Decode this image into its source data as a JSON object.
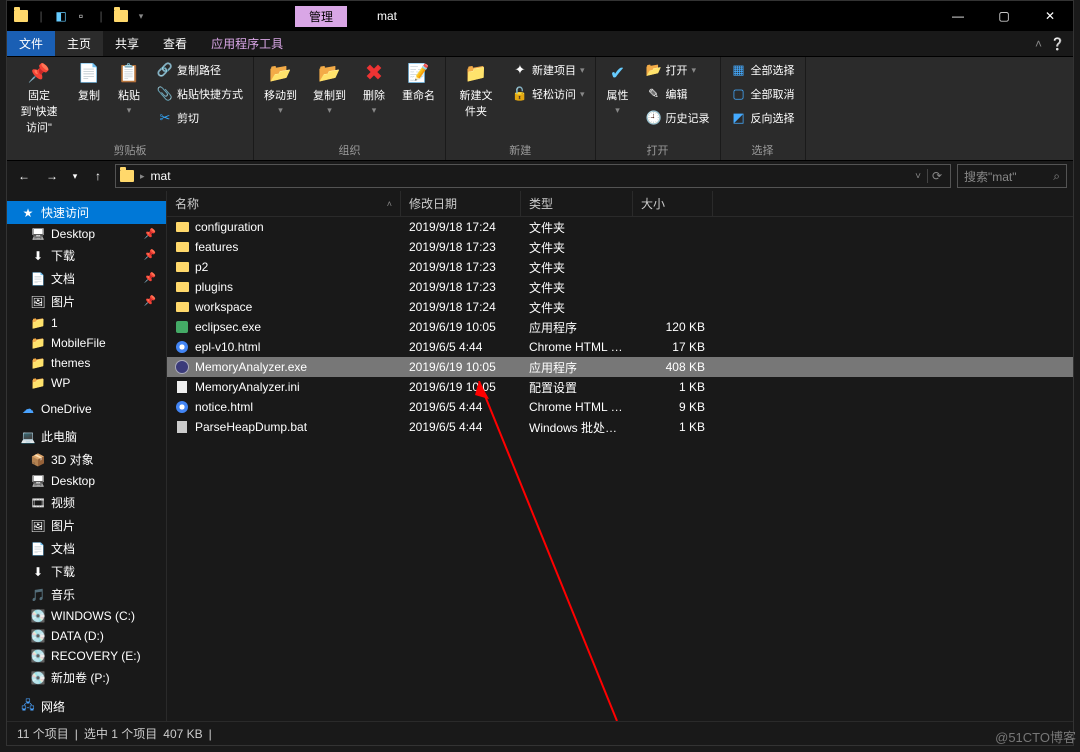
{
  "titlebar": {
    "context_tab": "管理",
    "title": "mat"
  },
  "ribbon_tabs": {
    "file": "文件",
    "home": "主页",
    "share": "共享",
    "view": "查看",
    "tools": "应用程序工具"
  },
  "ribbon": {
    "pin": "固定到\"快速访问\"",
    "copy": "复制",
    "paste": "粘贴",
    "copy_path": "复制路径",
    "paste_shortcut": "粘贴快捷方式",
    "cut": "剪切",
    "clipboard_group": "剪贴板",
    "move_to": "移动到",
    "copy_to": "复制到",
    "delete": "删除",
    "rename": "重命名",
    "organize_group": "组织",
    "new_folder": "新建文件夹",
    "new_item": "新建项目",
    "easy_access": "轻松访问",
    "new_group": "新建",
    "properties": "属性",
    "open": "打开",
    "edit": "编辑",
    "history": "历史记录",
    "open_group": "打开",
    "select_all": "全部选择",
    "select_none": "全部取消",
    "invert": "反向选择",
    "select_group": "选择"
  },
  "address": {
    "path": "mat",
    "search_placeholder": "搜索\"mat\""
  },
  "columns": {
    "name": "名称",
    "date": "修改日期",
    "type": "类型",
    "size": "大小"
  },
  "files": [
    {
      "icon": "folder",
      "name": "configuration",
      "date": "2019/9/18 17:24",
      "type": "文件夹",
      "size": ""
    },
    {
      "icon": "folder",
      "name": "features",
      "date": "2019/9/18 17:23",
      "type": "文件夹",
      "size": ""
    },
    {
      "icon": "folder",
      "name": "p2",
      "date": "2019/9/18 17:23",
      "type": "文件夹",
      "size": ""
    },
    {
      "icon": "folder",
      "name": "plugins",
      "date": "2019/9/18 17:23",
      "type": "文件夹",
      "size": ""
    },
    {
      "icon": "folder",
      "name": "workspace",
      "date": "2019/9/18 17:24",
      "type": "文件夹",
      "size": ""
    },
    {
      "icon": "exe",
      "name": "eclipsec.exe",
      "date": "2019/6/19 10:05",
      "type": "应用程序",
      "size": "120 KB"
    },
    {
      "icon": "html",
      "name": "epl-v10.html",
      "date": "2019/6/5 4:44",
      "type": "Chrome HTML D...",
      "size": "17 KB"
    },
    {
      "icon": "ecl",
      "name": "MemoryAnalyzer.exe",
      "date": "2019/6/19 10:05",
      "type": "应用程序",
      "size": "408 KB",
      "selected": true
    },
    {
      "icon": "ini",
      "name": "MemoryAnalyzer.ini",
      "date": "2019/6/19 10:05",
      "type": "配置设置",
      "size": "1 KB"
    },
    {
      "icon": "html",
      "name": "notice.html",
      "date": "2019/6/5 4:44",
      "type": "Chrome HTML D...",
      "size": "9 KB"
    },
    {
      "icon": "bat",
      "name": "ParseHeapDump.bat",
      "date": "2019/6/5 4:44",
      "type": "Windows 批处理...",
      "size": "1 KB"
    }
  ],
  "sidebar": {
    "quick": "快速访问",
    "items1": [
      {
        "label": "Desktop",
        "pin": true,
        "icon": "🖥"
      },
      {
        "label": "下载",
        "pin": true,
        "icon": "⬇"
      },
      {
        "label": "文档",
        "pin": true,
        "icon": "📄"
      },
      {
        "label": "图片",
        "pin": true,
        "icon": "🖼"
      },
      {
        "label": "1",
        "pin": false,
        "icon": "📁"
      },
      {
        "label": "MobileFile",
        "pin": false,
        "icon": "📁"
      },
      {
        "label": "themes",
        "pin": false,
        "icon": "📁"
      },
      {
        "label": "WP",
        "pin": false,
        "icon": "📁"
      }
    ],
    "onedrive": "OneDrive",
    "thispc": "此电脑",
    "items2": [
      {
        "label": "3D 对象",
        "icon": "📦"
      },
      {
        "label": "Desktop",
        "icon": "🖥"
      },
      {
        "label": "视频",
        "icon": "🎞"
      },
      {
        "label": "图片",
        "icon": "🖼"
      },
      {
        "label": "文档",
        "icon": "📄"
      },
      {
        "label": "下载",
        "icon": "⬇"
      },
      {
        "label": "音乐",
        "icon": "🎵"
      },
      {
        "label": "WINDOWS (C:)",
        "icon": "💽"
      },
      {
        "label": "DATA (D:)",
        "icon": "💽"
      },
      {
        "label": "RECOVERY (E:)",
        "icon": "💽"
      },
      {
        "label": "新加卷 (P:)",
        "icon": "💽"
      }
    ],
    "network": "网络"
  },
  "status": {
    "count": "11 个项目",
    "selection": "选中 1 个项目",
    "size": "407 KB"
  },
  "watermark": "@51CTO博客"
}
